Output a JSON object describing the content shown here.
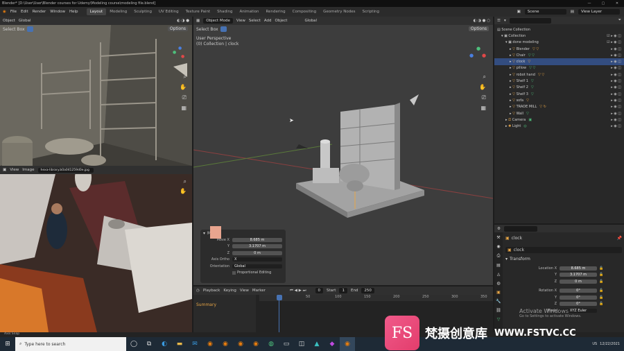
{
  "titlebar": {
    "title": "Blender* [D:\\User\\User\\Blender courses for Udemy\\Modeling course\\modeling file.blend]",
    "min": "—",
    "max": "▢",
    "close": "✕"
  },
  "menubar": {
    "file": "File",
    "edit": "Edit",
    "render": "Render",
    "window": "Window",
    "help": "Help",
    "workspaces": [
      "Layout",
      "Modeling",
      "Sculpting",
      "UV Editing",
      "Texture Paint",
      "Shading",
      "Animation",
      "Rendering",
      "Compositing",
      "Geometry Nodes",
      "Scripting"
    ],
    "active_workspace": "Layout",
    "scene": "Scene",
    "view_layer": "View Layer"
  },
  "left_viewport": {
    "mode": "Object",
    "orientation": "Global",
    "select_box": "Select Box",
    "options": "Options"
  },
  "image_editor": {
    "view": "View",
    "image": "Image",
    "filename": "hexa-library.b0a041259d0e.jpg"
  },
  "main_viewport": {
    "mode": "Object Mode",
    "view": "View",
    "select": "Select",
    "add": "Add",
    "object": "Object",
    "orientation": "Global",
    "select_box": "Select Box",
    "options": "Options",
    "perspective": "User Perspective",
    "collection_info": "(0) Collection | clock"
  },
  "operator_panel": {
    "title": "Move",
    "move_x_label": "Move X",
    "move_x": "8.685 m",
    "y_label": "Y",
    "y": "3.1707 m",
    "z_label": "Z",
    "z": "0 m",
    "axis_ortho_label": "Axis Ortho",
    "axis_ortho": "X",
    "orientation_label": "Orientation",
    "orientation": "Global",
    "proportional": "Proportional Editing"
  },
  "timeline": {
    "playback": "Playback",
    "keying": "Keying",
    "view": "View",
    "marker": "Marker",
    "current_frame": "0",
    "start_label": "Start",
    "start": "1",
    "end_label": "End",
    "end": "250",
    "ticks": [
      "0",
      "50",
      "100",
      "150",
      "200",
      "250",
      "300",
      "350"
    ],
    "summary": "Summary"
  },
  "outliner": {
    "search_placeholder": "",
    "items": [
      {
        "label": "Scene Collection",
        "indent": 0
      },
      {
        "label": "Collection",
        "indent": 1
      },
      {
        "label": "done modeling",
        "indent": 2
      },
      {
        "label": "Blender",
        "indent": 3
      },
      {
        "label": "Chair",
        "indent": 3
      },
      {
        "label": "clock",
        "indent": 3,
        "selected": true
      },
      {
        "label": "pillow",
        "indent": 3
      },
      {
        "label": "robot hand",
        "indent": 3
      },
      {
        "label": "Shelf 1",
        "indent": 3
      },
      {
        "label": "Shelf 2",
        "indent": 3
      },
      {
        "label": "Shelf 3",
        "indent": 3
      },
      {
        "label": "sofa",
        "indent": 3
      },
      {
        "label": "TRADE MILL",
        "indent": 3
      },
      {
        "label": "Wall",
        "indent": 3
      },
      {
        "label": "Camera",
        "indent": 2
      },
      {
        "label": "Light",
        "indent": 2
      }
    ]
  },
  "properties": {
    "object_name": "clock",
    "data_name": "clock",
    "transform": "Transform",
    "location_x_label": "Location X",
    "location_x": "8.685 m",
    "location_y_label": "Y",
    "location_y": "3.1707 m",
    "location_z_label": "Z",
    "location_z": "0 m",
    "rotation_x_label": "Rotation X",
    "rotation_x": "0°",
    "rotation_y_label": "Y",
    "rotation_y": "0°",
    "rotation_z_label": "Z",
    "rotation_z": "0°",
    "mode_label": "Mode",
    "mode": "XYZ Euler",
    "activate": "Activate Windows",
    "activate_sub": "Go to Settings to activate Windows."
  },
  "status": {
    "text": "Axis Snap"
  },
  "taskbar": {
    "search_placeholder": "Type here to search",
    "lang": "US",
    "date": "12/22/2021"
  },
  "watermark": {
    "logo": "FS",
    "cn": "梵摄创意库",
    "url": "WWW.FSTVC.CC"
  },
  "colors": {
    "accent": "#4772b3",
    "selection": "#334d80",
    "active_orange": "#e8a646",
    "mesh_green": "#4ec07c",
    "brand_pink": "#e33d6c"
  }
}
